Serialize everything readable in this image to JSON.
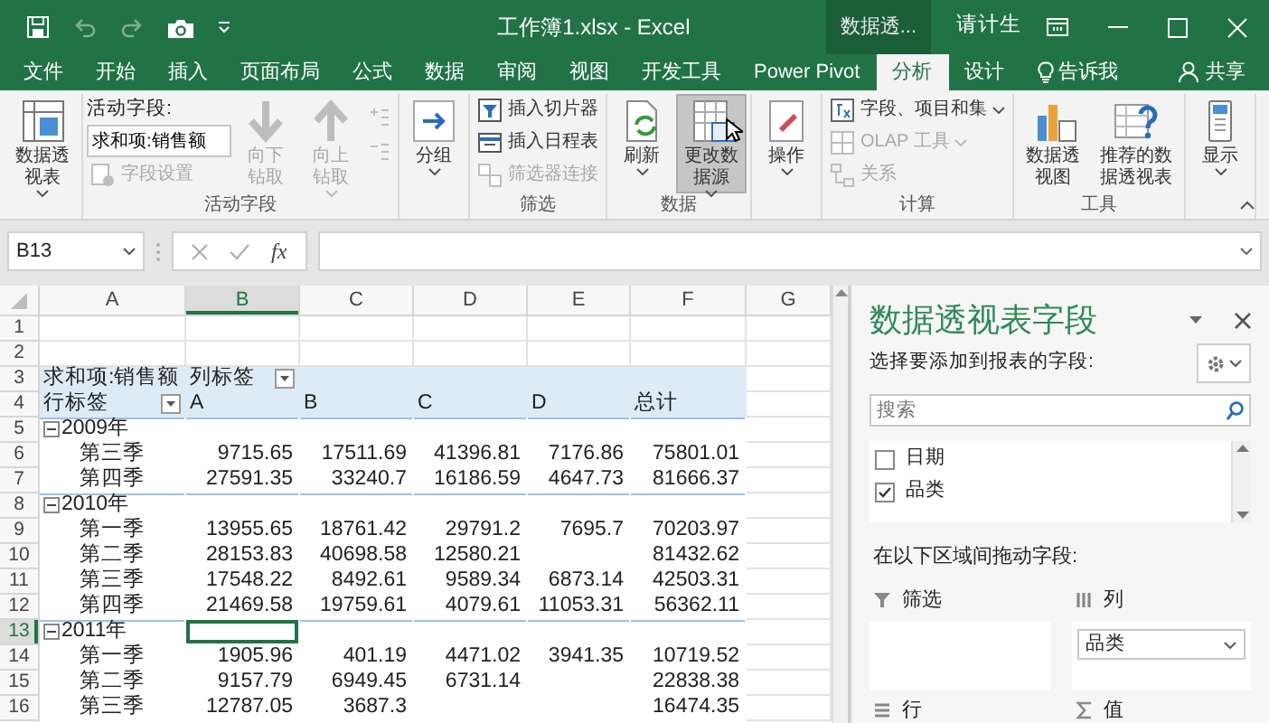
{
  "title_bar": {
    "title": "工作簿1.xlsx - Excel",
    "context_label": "数据透...",
    "user": "请计生"
  },
  "quick_access": [
    {
      "disabled": false
    },
    {
      "disabled": true
    },
    {
      "disabled": true
    },
    {
      "disabled": false
    }
  ],
  "tabs": [
    {
      "label": "文件",
      "selected": false
    },
    {
      "label": "开始",
      "selected": false
    },
    {
      "label": "插入",
      "selected": false
    },
    {
      "label": "页面布局",
      "selected": false
    },
    {
      "label": "公式",
      "selected": false
    },
    {
      "label": "数据",
      "selected": false
    },
    {
      "label": "审阅",
      "selected": false
    },
    {
      "label": "视图",
      "selected": false
    },
    {
      "label": "开发工具",
      "selected": false
    },
    {
      "label": "Power Pivot",
      "selected": false
    },
    {
      "label": "分析",
      "selected": true
    },
    {
      "label": "设计",
      "selected": false
    }
  ],
  "tell_me": "告诉我",
  "share": "共享",
  "ribbon": {
    "groups": [
      {
        "items": [
          {
            "kind": "large",
            "label": "数据透视表",
            "dropdown": true,
            "disabled": false,
            "hovered": false
          }
        ]
      },
      {
        "label": "活动字段",
        "items": [
          {
            "kind": "caption",
            "label": "活动字段:"
          },
          {
            "kind": "input",
            "value": "求和项:销售额"
          },
          {
            "kind": "small",
            "label": "字段设置",
            "dropdown": false,
            "disabled": true
          },
          {
            "kind": "large",
            "label": "向下钻取",
            "dropdown": false,
            "disabled": true,
            "hovered": false
          },
          {
            "kind": "large",
            "label": "向上钻取",
            "dropdown": true,
            "disabled": true,
            "hovered": false
          },
          {
            "kind": "mini",
            "disabled": true
          },
          {
            "kind": "mini",
            "disabled": true
          }
        ]
      },
      {
        "items": [
          {
            "kind": "large",
            "label": "分组",
            "dropdown": true,
            "disabled": false,
            "hovered": false
          }
        ]
      },
      {
        "label": "筛选",
        "items": [
          {
            "kind": "small",
            "label": "插入切片器",
            "dropdown": false,
            "disabled": false
          },
          {
            "kind": "small",
            "label": "插入日程表",
            "dropdown": false,
            "disabled": false
          },
          {
            "kind": "small",
            "label": "筛选器连接",
            "dropdown": false,
            "disabled": true
          }
        ]
      },
      {
        "label": "数据",
        "items": [
          {
            "kind": "large",
            "label": "刷新",
            "dropdown": true,
            "disabled": false,
            "hovered": false
          },
          {
            "kind": "large",
            "label": "更改数据源",
            "dropdown": true,
            "disabled": false,
            "hovered": true
          }
        ]
      },
      {
        "items": [
          {
            "kind": "large",
            "label": "操作",
            "dropdown": true,
            "disabled": false,
            "hovered": false
          }
        ]
      },
      {
        "label": "计算",
        "items": [
          {
            "kind": "small",
            "label": "字段、项目和集",
            "dropdown": true,
            "disabled": false
          },
          {
            "kind": "small",
            "label": "OLAP 工具",
            "dropdown": true,
            "disabled": true
          },
          {
            "kind": "small",
            "label": "关系",
            "dropdown": false,
            "disabled": true
          }
        ]
      },
      {
        "label": "工具",
        "items": [
          {
            "kind": "large",
            "label": "数据透视图",
            "dropdown": false,
            "disabled": false,
            "hovered": false
          },
          {
            "kind": "large",
            "label": "推荐的数据透视表",
            "dropdown": false,
            "disabled": false,
            "hovered": false
          }
        ]
      },
      {
        "items": [
          {
            "kind": "large",
            "label": "显示",
            "dropdown": true,
            "disabled": false,
            "hovered": false
          }
        ]
      }
    ]
  },
  "formula_bar": {
    "name_box": "B13",
    "function_button": "fx"
  },
  "sheet": {
    "columns": [
      {
        "label": "A",
        "selected": false
      },
      {
        "label": "B",
        "selected": true
      },
      {
        "label": "C",
        "selected": false
      },
      {
        "label": "D",
        "selected": false
      },
      {
        "label": "E",
        "selected": false
      },
      {
        "label": "F",
        "selected": false
      },
      {
        "label": "G",
        "selected": false
      }
    ],
    "rows": [
      {
        "number": "1",
        "kind": "blank",
        "selected": false
      },
      {
        "number": "2",
        "kind": "blank",
        "selected": false
      },
      {
        "number": "3",
        "kind": "pivot_header",
        "selected": false,
        "label": "求和项:销售额",
        "column_label": "列标签"
      },
      {
        "number": "4",
        "kind": "pivot_columns",
        "selected": false,
        "label": "行标签",
        "headings": [
          "A",
          "B",
          "C",
          "D",
          "总计"
        ]
      },
      {
        "number": "5",
        "kind": "year",
        "selected": false,
        "label": "2009年",
        "expanded": true
      },
      {
        "number": "6",
        "kind": "quarter",
        "selected": false,
        "label": "第三季",
        "values": {
          "B": "9715.65",
          "C": "17511.69",
          "D": "41396.81",
          "E": "7176.86",
          "F": "75801.01"
        }
      },
      {
        "number": "7",
        "kind": "quarter",
        "selected": false,
        "label": "第四季",
        "values": {
          "B": "27591.35",
          "C": "33240.7",
          "D": "16186.59",
          "E": "4647.73",
          "F": "81666.37"
        }
      },
      {
        "number": "8",
        "kind": "year",
        "selected": false,
        "label": "2010年",
        "expanded": true
      },
      {
        "number": "9",
        "kind": "quarter",
        "selected": false,
        "label": "第一季",
        "values": {
          "B": "13955.65",
          "C": "18761.42",
          "D": "29791.2",
          "E": "7695.7",
          "F": "70203.97"
        }
      },
      {
        "number": "10",
        "kind": "quarter",
        "selected": false,
        "label": "第二季",
        "values": {
          "B": "28153.83",
          "C": "40698.58",
          "D": "12580.21",
          "F": "81432.62"
        }
      },
      {
        "number": "11",
        "kind": "quarter",
        "selected": false,
        "label": "第三季",
        "values": {
          "B": "17548.22",
          "C": "8492.61",
          "D": "9589.34",
          "E": "6873.14",
          "F": "42503.31"
        }
      },
      {
        "number": "12",
        "kind": "quarter",
        "selected": false,
        "label": "第四季",
        "values": {
          "B": "21469.58",
          "C": "19759.61",
          "D": "4079.61",
          "E": "11053.31",
          "F": "56362.11"
        }
      },
      {
        "number": "13",
        "kind": "year",
        "selected": true,
        "label": "2011年",
        "expanded": true
      },
      {
        "number": "14",
        "kind": "quarter",
        "selected": false,
        "label": "第一季",
        "values": {
          "B": "1905.96",
          "C": "401.19",
          "D": "4471.02",
          "E": "3941.35",
          "F": "10719.52"
        }
      },
      {
        "number": "15",
        "kind": "quarter",
        "selected": false,
        "label": "第二季",
        "values": {
          "B": "9157.79",
          "C": "6949.45",
          "D": "6731.14",
          "F": "22838.38"
        }
      },
      {
        "number": "16",
        "kind": "quarter",
        "selected": false,
        "label": "第三季",
        "values": {
          "B": "12787.05",
          "C": "3687.3",
          "F": "16474.35"
        }
      }
    ]
  },
  "task_pane": {
    "title": "数据透视表字段",
    "prompt": "选择要添加到报表的字段:",
    "search_placeholder": "搜索",
    "fields": [
      {
        "label": "日期",
        "checked": false
      },
      {
        "label": "品类",
        "checked": true
      }
    ],
    "areas_prompt": "在以下区域间拖动字段:",
    "areas": [
      {
        "label": "筛选"
      },
      {
        "label": "列",
        "items": [
          "品类"
        ]
      },
      {
        "label": "行"
      },
      {
        "label": "值"
      }
    ]
  }
}
